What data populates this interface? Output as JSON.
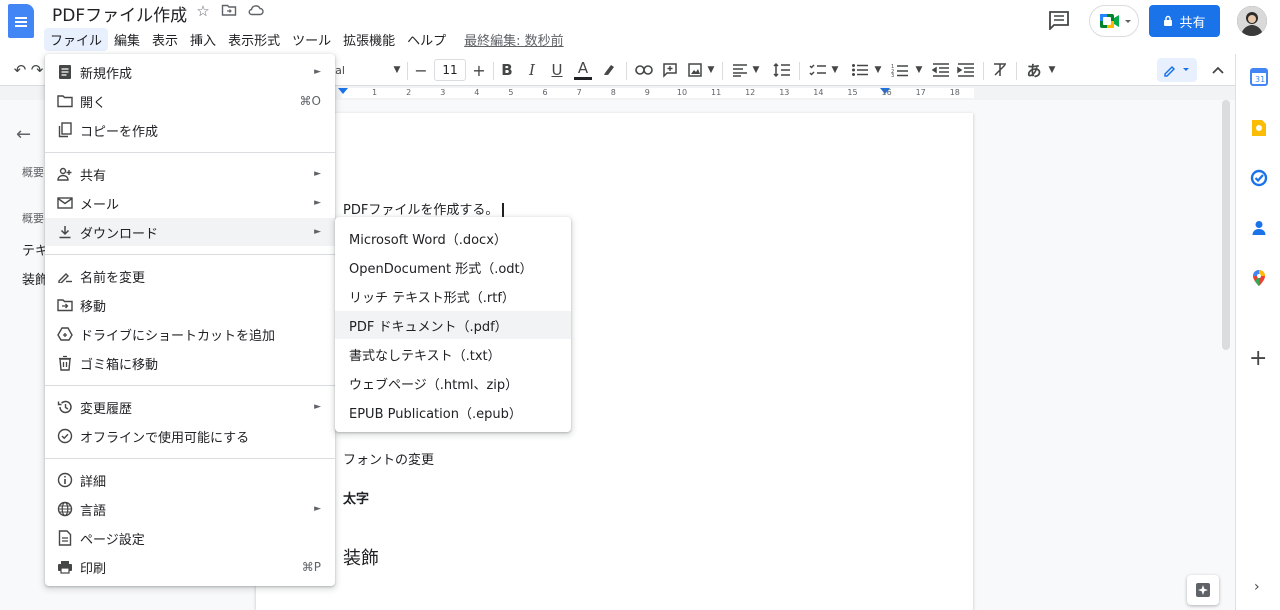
{
  "app": {
    "doc_title": "PDFファイル作成",
    "last_edit": "最終編集: 数秒前",
    "share_label": "共有"
  },
  "menubar": [
    "ファイル",
    "編集",
    "表示",
    "挿入",
    "表示形式",
    "ツール",
    "拡張機能",
    "ヘルプ"
  ],
  "toolbar": {
    "font_name_partial": "al",
    "font_size": "11",
    "bold": "B",
    "italic": "I",
    "underline": "U",
    "text_color": "A",
    "input_tools": "あ"
  },
  "ruler": {
    "numbers": [
      "1",
      "2",
      "3",
      "4",
      "5",
      "6",
      "7",
      "8",
      "9",
      "10",
      "11",
      "12",
      "13",
      "14",
      "15",
      "16",
      "17",
      "18"
    ]
  },
  "outline": {
    "summary_label": "概要",
    "summary_label2": "概要",
    "heading_partial_1": "テキ",
    "heading_partial_2": "装飾"
  },
  "document": {
    "line1": "PDFファイルを作成する。",
    "font_change": "フォントの変更",
    "bold_text": "太字",
    "heading": "装飾"
  },
  "file_menu": {
    "items": [
      {
        "label": "新規作成",
        "icon": "doc-new-icon",
        "arrow": "►"
      },
      {
        "label": "開く",
        "icon": "folder-icon",
        "shortcut": "⌘O"
      },
      {
        "label": "コピーを作成",
        "icon": "copy-icon"
      },
      {
        "label": "共有",
        "icon": "person-add-icon",
        "arrow": "►"
      },
      {
        "label": "メール",
        "icon": "mail-icon",
        "arrow": "►"
      },
      {
        "label": "ダウンロード",
        "icon": "download-icon",
        "arrow": "►"
      },
      {
        "label": "名前を変更",
        "icon": "rename-icon"
      },
      {
        "label": "移動",
        "icon": "move-folder-icon"
      },
      {
        "label": "ドライブにショートカットを追加",
        "icon": "drive-shortcut-icon"
      },
      {
        "label": "ゴミ箱に移動",
        "icon": "trash-icon"
      },
      {
        "label": "変更履歴",
        "icon": "history-icon",
        "arrow": "►"
      },
      {
        "label": "オフラインで使用可能にする",
        "icon": "offline-icon"
      },
      {
        "label": "詳細",
        "icon": "info-icon"
      },
      {
        "label": "言語",
        "icon": "globe-icon",
        "arrow": "►"
      },
      {
        "label": "ページ設定",
        "icon": "page-setup-icon"
      },
      {
        "label": "印刷",
        "icon": "print-icon",
        "shortcut": "⌘P"
      }
    ]
  },
  "download_menu": {
    "items": [
      "Microsoft Word（.docx）",
      "OpenDocument 形式（.odt）",
      "リッチ テキスト形式（.rtf）",
      "PDF ドキュメント（.pdf）",
      "書式なしテキスト（.txt）",
      "ウェブページ（.html、zip）",
      "EPUB Publication（.epub）"
    ]
  }
}
